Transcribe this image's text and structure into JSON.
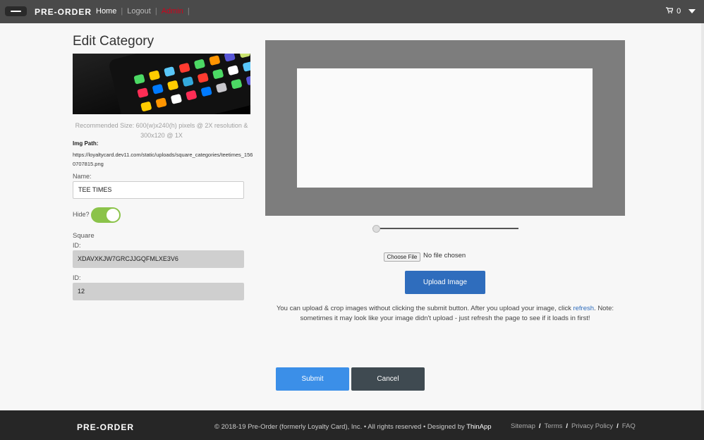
{
  "header": {
    "brand": "PRE-ORDER",
    "nav": {
      "home": "Home",
      "logout": "Logout",
      "admin": "Admin",
      "separator": "|"
    },
    "cart_icon": "⎮",
    "cart_count": "0"
  },
  "edit": {
    "title": "Edit Category",
    "recommended_size": "Recommended Size: 600(w)x240(h) pixels @ 2X resolution & 300x120 @ 1X",
    "img_path_label": "Img Path:",
    "img_path": "https://loyaltycard.dev11.com/static/uploads/square_categories/teetimes_1560707815.png",
    "name_label": "Name:",
    "name_value": "TEE TIMES",
    "hide_label": "Hide?",
    "hide_on": true,
    "square_label": "Square",
    "square_id_label": "ID:",
    "square_id_value": "XDAVXKJW7GRCJJGQFMLXE3V6",
    "id_label": "ID:",
    "id_value": "12"
  },
  "uploader": {
    "choose_file": "Choose File",
    "no_file": "No file chosen",
    "upload_button": "Upload Image",
    "help_before": "You can upload & crop images without clicking the submit button. After you upload your image, click ",
    "help_link": "refresh",
    "help_after": ". Note: sometimes it may look like your image didn't upload - just refresh the page to see if it loads in first!",
    "zoom": 0
  },
  "actions": {
    "submit": "Submit",
    "cancel": "Cancel"
  },
  "footer": {
    "brand": "PRE-ORDER",
    "copyright": "© 2018-19 Pre-Order (formerly Loyalty Card), Inc. • All rights reserved • Designed by ",
    "designer": "ThinApp",
    "links": {
      "sitemap": "Sitemap",
      "terms": "Terms",
      "privacy": "Privacy Policy",
      "faq": "FAQ"
    },
    "separator": "/"
  },
  "colors": {
    "header_bg": "#4a4a4a",
    "upload_blue": "#2f6dbd",
    "submit_blue": "#3b8fe8",
    "cancel_dark": "#3f4a51",
    "toggle_green": "#8bc34a",
    "admin_red": "#d0021b"
  }
}
